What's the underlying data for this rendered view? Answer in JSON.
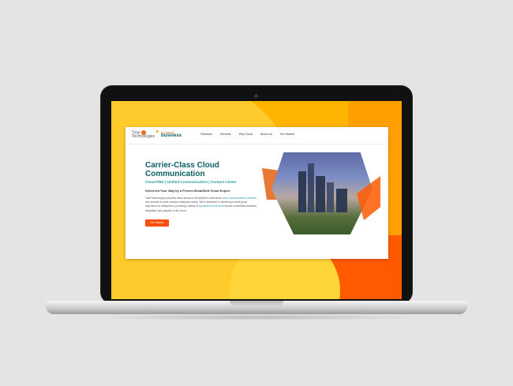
{
  "site": {
    "logo": {
      "name_line1": "Total",
      "name_line2": "Technologies"
    },
    "partner": {
      "small": "broadsoft",
      "big": "business"
    },
    "nav": [
      "Solutions",
      "Services",
      "Why Cloud",
      "About Us",
      "Get Started"
    ],
    "hero": {
      "title": "Carrier-Class Cloud Communication",
      "subtitle": "Cloud PBX | Unified Communication | Contact Center",
      "tagline": "Delivered Your Way by a Proven BroadSoft Cloud Expert",
      "body_parts": [
        "Total Technologies provides direct access to BroadSoft's customized ",
        "cloud communication solutions",
        " and services to meet complex enterprise needs. We're dedicated to delivering a white-glove experience to enterprises, providing a variety of ",
        "specialized services",
        " to ensure a seamless transition, integration and adoption to the cloud."
      ],
      "cta": "Get Started"
    }
  }
}
